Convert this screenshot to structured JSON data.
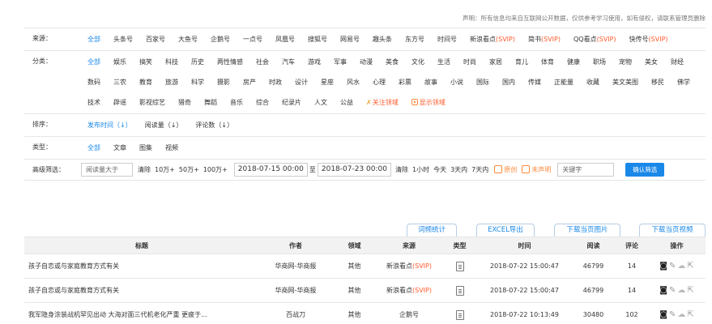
{
  "notice": "声明：所有信息均来自互联网公开数据，仅供参考学习使用，如有侵权，请联系管理员删除",
  "source_row": {
    "label": "来源：",
    "items": [
      {
        "text": "全部",
        "svip": ""
      },
      {
        "text": "头条号",
        "svip": ""
      },
      {
        "text": "百家号",
        "svip": ""
      },
      {
        "text": "大鱼号",
        "svip": ""
      },
      {
        "text": "企鹅号",
        "svip": ""
      },
      {
        "text": "一点号",
        "svip": ""
      },
      {
        "text": "凤凰号",
        "svip": ""
      },
      {
        "text": "搜狐号",
        "svip": ""
      },
      {
        "text": "网易号",
        "svip": ""
      },
      {
        "text": "趣头条",
        "svip": ""
      },
      {
        "text": "东方号",
        "svip": ""
      },
      {
        "text": "时间号",
        "svip": ""
      },
      {
        "text": "新浪看点",
        "svip": "(SVIP)"
      },
      {
        "text": "简书",
        "svip": "(SVIP)"
      },
      {
        "text": "QQ看点",
        "svip": "(SVIP)"
      },
      {
        "text": "快传号",
        "svip": "(SVIP)"
      }
    ]
  },
  "category_row": {
    "label": "分类：",
    "items": [
      "全部",
      "娱乐",
      "搞笑",
      "科技",
      "历史",
      "两性情感",
      "社会",
      "汽车",
      "游戏",
      "军事",
      "动漫",
      "美食",
      "文化",
      "生活",
      "时尚",
      "家居",
      "育儿",
      "体育",
      "健康",
      "职场",
      "宠物",
      "美女",
      "财经",
      "数码",
      "三农",
      "教育",
      "旅游",
      "科学",
      "摄影",
      "房产",
      "时政",
      "设计",
      "星座",
      "风水",
      "心理",
      "彩票",
      "故事",
      "小说",
      "国际",
      "国内",
      "传媒",
      "正能量",
      "收藏",
      "美文美图",
      "移民",
      "佛学",
      "技术",
      "辟谣",
      "影视综艺",
      "猎奇",
      "舞蹈",
      "音乐",
      "综合",
      "纪录片",
      "人文",
      "公益"
    ],
    "follow": "关注领域",
    "show": "显示领域"
  },
  "sort_row": {
    "label": "排序：",
    "items": [
      "发布时间（↓）",
      "阅读量（↓）",
      "评论数（↓）"
    ]
  },
  "type_row": {
    "label": "类型：",
    "items": [
      "全部",
      "文章",
      "图集",
      "视频"
    ]
  },
  "advanced_row": {
    "label": "高级筛选：",
    "read_placeholder": "阅读量大于",
    "clear1": "清除",
    "r1": "10万+",
    "r2": "50万+",
    "r3": "100万+",
    "date_from": "2018-07-15 00:00",
    "to": "至",
    "date_to": "2018-07-23 00:00",
    "clear2": "清除",
    "t1": "1小时",
    "t2": "今天",
    "t3": "3天内",
    "t4": "7天内",
    "original": "原创",
    "unknown": "未声明",
    "keyword_placeholder": "关键字",
    "confirm": "确认筛选"
  },
  "tabs": {
    "word_stats": "词频统计",
    "excel": "EXCEL导出",
    "download_images": "下载当页图片",
    "download_videos": "下载当页视频"
  },
  "table": {
    "headers": {
      "title": "标题",
      "author": "作者",
      "field": "领域",
      "source": "来源",
      "type": "类型",
      "time": "时间",
      "read": "阅读",
      "comment": "评论",
      "ops": "操作"
    },
    "rows": [
      {
        "title": "孩子自恋或与家庭教育方式有关",
        "author": "华商网-华商报",
        "field": "其他",
        "source": "新浪看点",
        "svip": "(SVIP)",
        "time": "2018-07-22 15:00:47",
        "read": "46799",
        "comment": "14"
      },
      {
        "title": "孩子自恋或与家庭教育方式有关",
        "author": "华商网-华商报",
        "field": "其他",
        "source": "新浪看点",
        "svip": "(SVIP)",
        "time": "2018-07-22 15:00:47",
        "read": "46799",
        "comment": "14"
      },
      {
        "title": "我军隐身涂装战机罕见出动 大海对面三代机老化严重 更疲于...",
        "author": "百战刀",
        "field": "其他",
        "source": "企鹅号",
        "svip": "",
        "time": "2018-07-22 10:13:49",
        "read": "30480",
        "comment": "102"
      }
    ]
  },
  "colors": {
    "accent": "#1a88e8",
    "svip": "#ff5a2c"
  }
}
